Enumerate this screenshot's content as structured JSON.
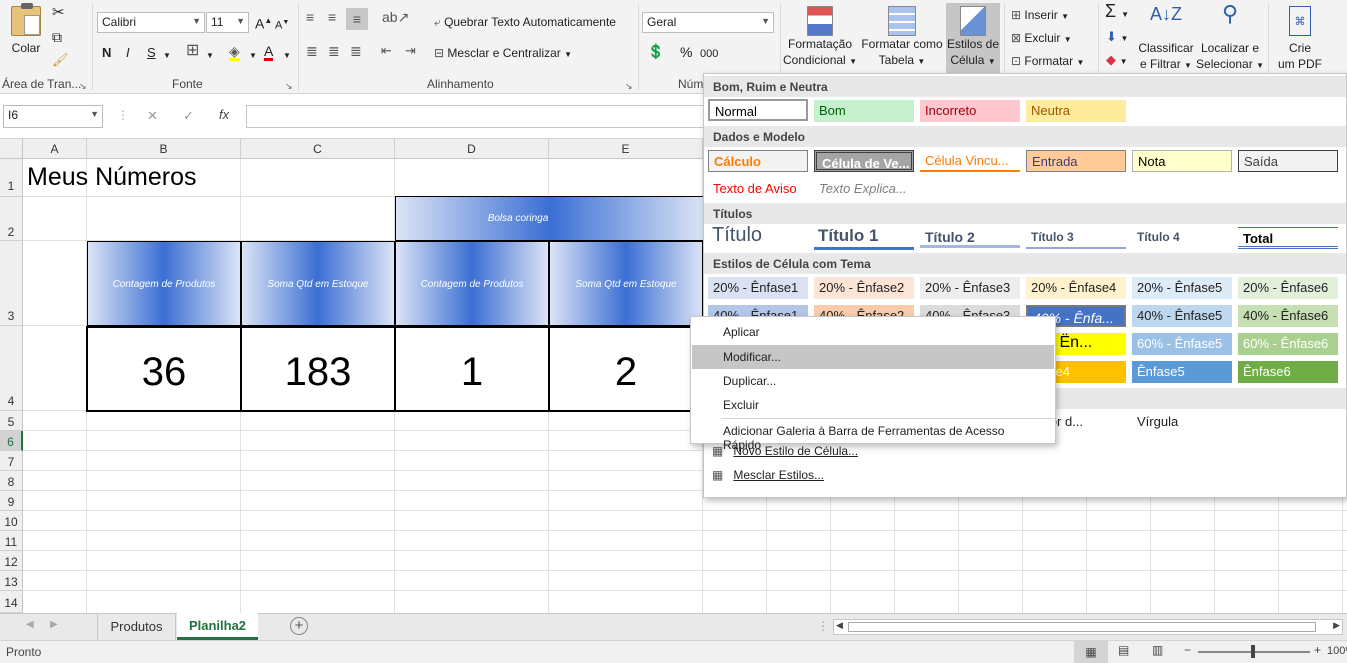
{
  "ribbon": {
    "clipboard": {
      "paste_label": "Colar",
      "group_label": "Área de Tran..."
    },
    "font": {
      "name": "Calibri",
      "size": "11",
      "bold": "N",
      "italic": "I",
      "underline": "S",
      "grow": "A",
      "shrink": "A",
      "font_color_glyph": "A",
      "group_label": "Fonte"
    },
    "alignment": {
      "wrap_label": "Quebrar Texto Automaticamente",
      "merge_label": "Mesclar e Centralizar",
      "group_label": "Alinhamento"
    },
    "number": {
      "format": "Geral",
      "percent": "%",
      "thousands": "000",
      "group_label": "Núm"
    },
    "styles": {
      "conditional_l1": "Formatação",
      "conditional_l2": "Condicional",
      "table_l1": "Formatar como",
      "table_l2": "Tabela",
      "cell_l1": "Estilos de",
      "cell_l2": "Célula"
    },
    "cells": {
      "insert_label": "Inserir",
      "delete_label": "Excluir",
      "format_label": "Formatar"
    },
    "editing": {
      "sort_l1": "Classificar",
      "sort_l2": "e Filtrar",
      "find_l1": "Localizar e",
      "find_l2": "Selecionar"
    },
    "pdf": {
      "l1": "Crie",
      "l2": "um PDF"
    }
  },
  "formula_bar": {
    "name_box": "I6",
    "cancel": "✕",
    "enter": "✓",
    "fx": "fx",
    "formula": ""
  },
  "sheet": {
    "columns": [
      "A",
      "B",
      "C",
      "D",
      "E"
    ],
    "rows": [
      "1",
      "2",
      "3",
      "4",
      "5",
      "6",
      "7",
      "8",
      "9",
      "10",
      "11",
      "12",
      "13",
      "14"
    ],
    "title": "Meus Números",
    "group_header": "Bolsa coringa",
    "headers": [
      "Contagem de Produtos",
      "Soma Qtd em Estoque",
      "Contagem de Produtos",
      "Soma Qtd em Estoque"
    ],
    "values": [
      "36",
      "183",
      "1",
      "2"
    ]
  },
  "gallery": {
    "sections": [
      "Bom, Ruim e Neutra",
      "Dados e Modelo",
      "Títulos",
      "Estilos de Célula com Tema",
      ""
    ],
    "good_bad": [
      "Normal",
      "Bom",
      "Incorreto",
      "Neutra"
    ],
    "data_model": [
      "Cálculo",
      "Célula de Ve...",
      "Célula Vincu...",
      "Entrada",
      "Nota",
      "Saída",
      "Texto de Aviso",
      "Texto Explica..."
    ],
    "titles": [
      "Título",
      "Título 1",
      "Título 2",
      "Título 3",
      "Título 4",
      "Total"
    ],
    "theme_20": [
      "20% - Ênfase1",
      "20% - Ênfase2",
      "20% - Ênfase3",
      "20% - Ênfase4",
      "20% - Ênfase5",
      "20% - Ênfase6"
    ],
    "theme_40": [
      "40% - Ênfase1",
      "40% - Ênfase2",
      "40% - Ênfase3",
      "40% - Ênfa...",
      "40% - Ênfase5",
      "40% - Ênfase6"
    ],
    "theme_60": [
      "% - Ën...",
      "60% - Ênfase5",
      "60% - Ênfase6"
    ],
    "theme_accent": [
      "nfase4",
      "Ênfase5",
      "Ênfase6"
    ],
    "number_format": [
      "rador d...",
      "Vírgula"
    ],
    "new_style": "Novo Estilo de Célula...",
    "merge_styles": "Mesclar Estilos..."
  },
  "context_menu": {
    "items": [
      "Aplicar",
      "Modificar...",
      "Duplicar...",
      "Excluir",
      "Adicionar Galeria à Barra de Ferramentas de Acesso Rápido"
    ]
  },
  "tabs": {
    "sheets": [
      "Produtos",
      "Planilha2"
    ],
    "add": "+"
  },
  "status": {
    "text": "Pronto",
    "zoom": "100%"
  },
  "colors": {
    "accent": "#217346",
    "header_blue": "#3b6fd4",
    "selection": "#c6c6c6"
  }
}
